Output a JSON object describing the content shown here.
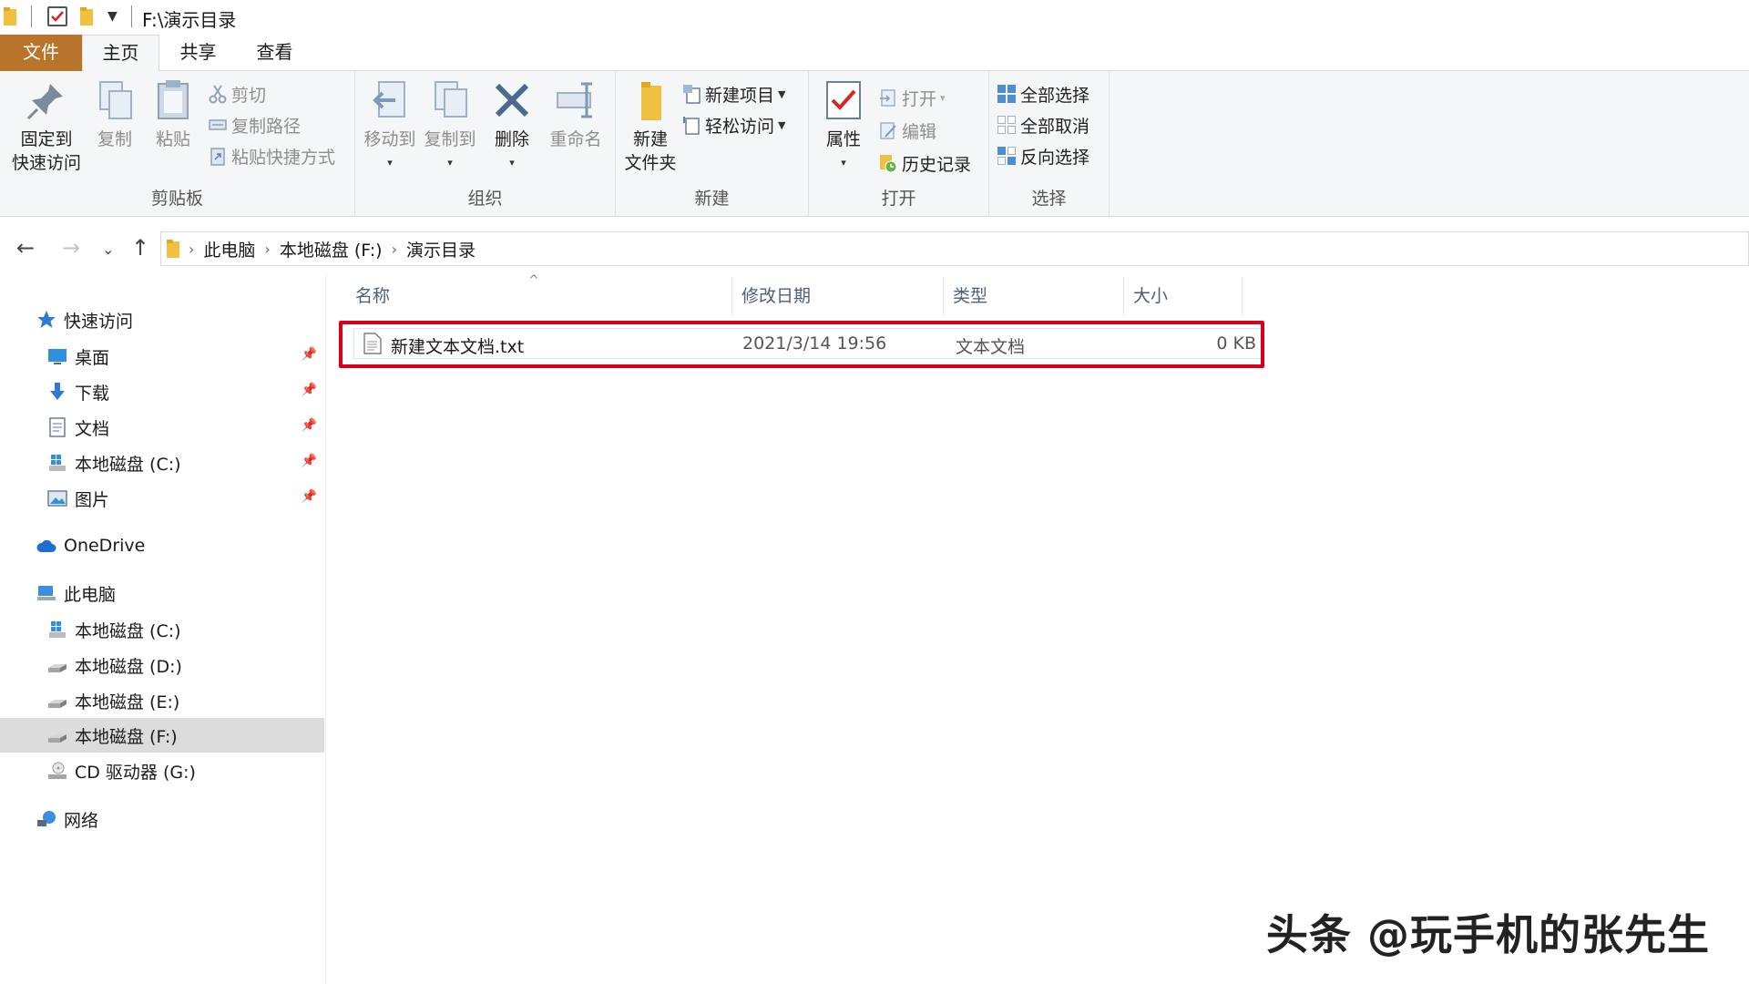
{
  "window": {
    "title": "F:\\演示目录"
  },
  "tabs": {
    "file": "文件",
    "home": "主页",
    "share": "共享",
    "view": "查看"
  },
  "ribbon": {
    "clipboard": {
      "label": "剪贴板",
      "pin_l1": "固定到",
      "pin_l2": "快速访问",
      "copy": "复制",
      "paste": "粘贴",
      "cut": "剪切",
      "copy_path": "复制路径",
      "paste_shortcut": "粘贴快捷方式"
    },
    "organize": {
      "label": "组织",
      "move_to": "移动到",
      "copy_to": "复制到",
      "delete": "删除",
      "rename": "重命名"
    },
    "new": {
      "label": "新建",
      "folder_l1": "新建",
      "folder_l2": "文件夹",
      "new_item": "新建项目",
      "easy_access": "轻松访问"
    },
    "open": {
      "label": "打开",
      "properties": "属性",
      "open": "打开",
      "edit": "编辑",
      "history": "历史记录"
    },
    "select": {
      "label": "选择",
      "select_all": "全部选择",
      "select_none": "全部取消",
      "invert": "反向选择"
    }
  },
  "address": {
    "segments": [
      "此电脑",
      "本地磁盘 (F:)",
      "演示目录"
    ]
  },
  "nav": {
    "quick_access": "快速访问",
    "desktop": "桌面",
    "downloads": "下载",
    "documents": "文档",
    "qa_c": "本地磁盘 (C:)",
    "pictures": "图片",
    "onedrive": "OneDrive",
    "this_pc": "此电脑",
    "c": "本地磁盘 (C:)",
    "d": "本地磁盘 (D:)",
    "e": "本地磁盘 (E:)",
    "f": "本地磁盘 (F:)",
    "g": "CD 驱动器 (G:)",
    "network": "网络"
  },
  "columns": {
    "name": "名称",
    "date": "修改日期",
    "type": "类型",
    "size": "大小"
  },
  "files": [
    {
      "name": "新建文本文档.txt",
      "date": "2021/3/14 19:56",
      "type": "文本文档",
      "size": "0 KB"
    }
  ],
  "watermark": "头条 @玩手机的张先生",
  "colors": {
    "file_tab": "#b7742a",
    "highlight": "#d8001b",
    "folder": "#f0c040"
  }
}
